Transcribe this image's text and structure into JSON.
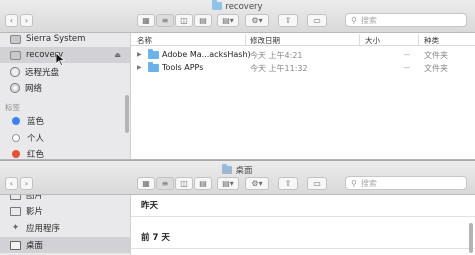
{
  "window_top": {
    "title": "recovery",
    "search_placeholder": "搜索",
    "sidebar": {
      "items": [
        {
          "label": "Sierra System",
          "icon": "disk-icon"
        },
        {
          "label": "recovery",
          "icon": "disk-icon",
          "eject": "⏏"
        },
        {
          "label": "远程光盘",
          "icon": "disc-icon"
        },
        {
          "label": "网络",
          "icon": "globe-icon"
        }
      ],
      "tags_header": "标签",
      "tags": [
        {
          "label": "蓝色",
          "color": "#3b82f6"
        },
        {
          "label": "个人",
          "color": "#ffffff"
        },
        {
          "label": "红色",
          "color": "#e5532d"
        }
      ]
    },
    "columns": {
      "name": "名称",
      "date": "修改日期",
      "size": "大小",
      "kind": "种类"
    },
    "rows": [
      {
        "name": "Adobe Ma...acksHash)",
        "date": "今天 上午4:21",
        "size": "--",
        "kind": "文件夹"
      },
      {
        "name": "Tools APPs",
        "date": "今天 上午11:32",
        "size": "--",
        "kind": "文件夹"
      }
    ]
  },
  "window_bottom": {
    "title": "桌面",
    "search_placeholder": "搜索",
    "sidebar": {
      "items": [
        {
          "label": "图片"
        },
        {
          "label": "影片"
        },
        {
          "label": "应用程序"
        },
        {
          "label": "桌面"
        }
      ]
    },
    "sections": [
      "昨天",
      "前 7 天"
    ]
  }
}
